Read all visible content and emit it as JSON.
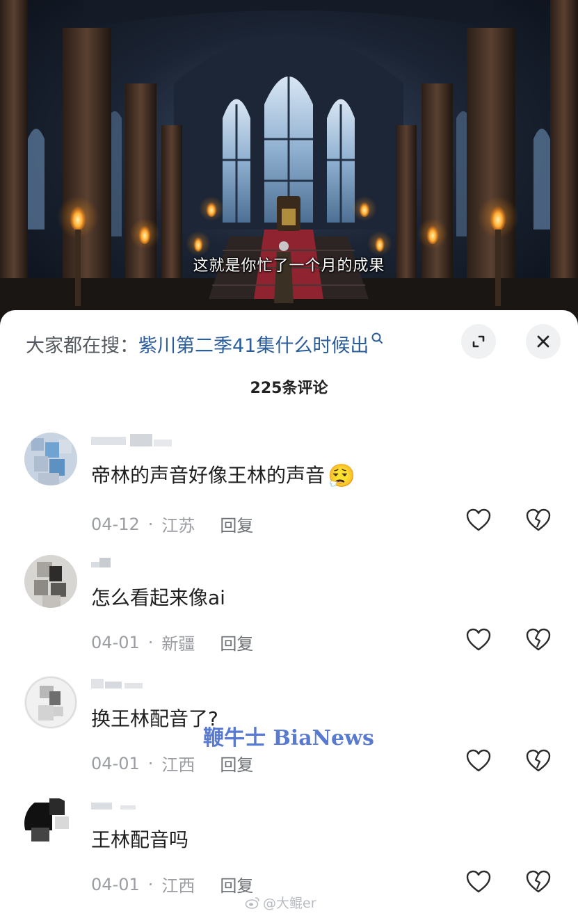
{
  "video": {
    "subtitle": "这就是你忙了一个月的成果"
  },
  "search": {
    "prefix": "大家都在搜：",
    "query": "紫川第二季41集什么时候出"
  },
  "comments_header": {
    "count_label": "225条评论"
  },
  "comments": [
    {
      "text": "帝林的声音好像王林的声音",
      "emoji": "😮‍💨",
      "date": "04-12",
      "location": "江苏",
      "reply_label": "回复"
    },
    {
      "text": "怎么看起来像ai",
      "emoji": "",
      "date": "04-01",
      "location": "新疆",
      "reply_label": "回复"
    },
    {
      "text": "换王林配音了?",
      "emoji": "",
      "date": "04-01",
      "location": "江西",
      "reply_label": "回复"
    },
    {
      "text": "王林配音吗",
      "emoji": "",
      "date": "04-01",
      "location": "江西",
      "reply_label": "回复"
    }
  ],
  "icons": {
    "search": "search-icon",
    "expand": "expand-icon",
    "close": "close-icon",
    "like": "heart-icon",
    "dislike": "broken-heart-icon"
  },
  "watermark": {
    "text": "鞭牛士 BiaNews",
    "weibo": "@大鲲er"
  },
  "colors": {
    "search_query": "#2b5d9a",
    "meta_text": "#9a9da2",
    "watermark": "#3d63c9"
  }
}
